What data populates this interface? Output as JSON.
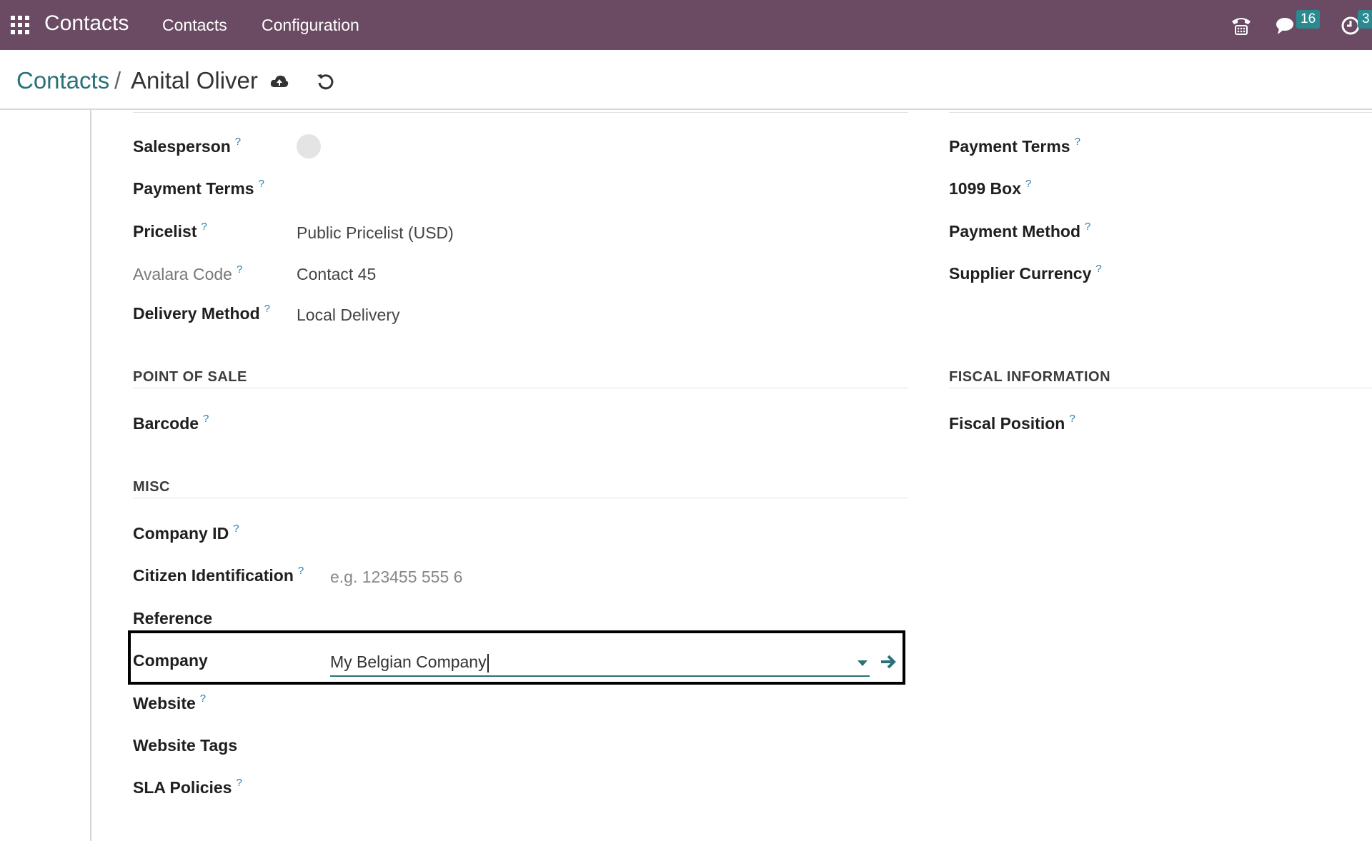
{
  "topbar": {
    "app_name": "Contacts",
    "menu": [
      "Contacts",
      "Configuration"
    ],
    "messages_count": "16",
    "activities_count": "3"
  },
  "breadcrumb": {
    "parent": "Contacts",
    "separator": "/",
    "current": "Anital Oliver"
  },
  "left_fields": {
    "salesperson_label": "Salesperson",
    "payment_terms_label": "Payment Terms",
    "pricelist_label": "Pricelist",
    "pricelist_value": "Public Pricelist (USD)",
    "avalara_label": "Avalara Code",
    "avalara_value": "Contact 45",
    "delivery_label": "Delivery Method",
    "delivery_value": "Local Delivery"
  },
  "pos": {
    "title": "POINT OF SALE",
    "barcode_label": "Barcode"
  },
  "misc": {
    "title": "MISC",
    "company_id_label": "Company ID",
    "citizen_label": "Citizen Identification",
    "citizen_placeholder": "e.g. 123455 555 6",
    "reference_label": "Reference",
    "company_label": "Company",
    "company_value": "My Belgian Company",
    "website_label": "Website",
    "website_tags_label": "Website Tags",
    "sla_label": "SLA Policies"
  },
  "right_fields": {
    "payment_terms_label": "Payment Terms",
    "box_1099_label": "1099 Box",
    "payment_method_label": "Payment Method",
    "supplier_currency_label": "Supplier Currency"
  },
  "fiscal": {
    "title": "FISCAL INFORMATION",
    "fiscal_position_label": "Fiscal Position"
  },
  "help_mark": "?",
  "colors": {
    "topbar": "#6b4a63",
    "accent": "#2a7178",
    "badge": "#2a8a8f"
  }
}
